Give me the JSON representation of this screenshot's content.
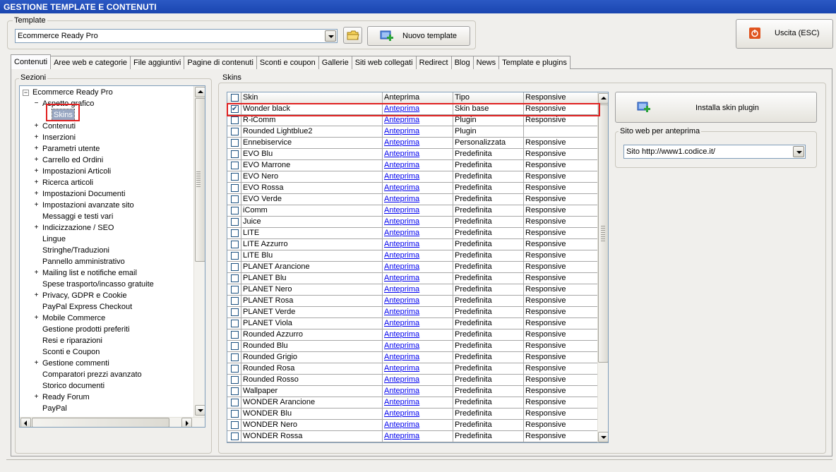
{
  "window": {
    "title": "GESTIONE TEMPLATE E CONTENUTI"
  },
  "template_group": {
    "label": "Template",
    "selected": "Ecommerce Ready Pro",
    "new_button": "Nuovo template"
  },
  "exit_button": "Uscita (ESC)",
  "tabs": [
    {
      "label": "Contenuti",
      "active": true
    },
    {
      "label": "Aree web e categorie"
    },
    {
      "label": "File aggiuntivi"
    },
    {
      "label": "Pagine di contenuti"
    },
    {
      "label": "Sconti e coupon"
    },
    {
      "label": "Gallerie"
    },
    {
      "label": "Siti web collegati"
    },
    {
      "label": "Redirect"
    },
    {
      "label": "Blog"
    },
    {
      "label": "News"
    },
    {
      "label": "Template e plugins"
    }
  ],
  "sections": {
    "label": "Sezioni",
    "root": "Ecommerce Ready Pro",
    "items": [
      {
        "label": "Aspetto grafico",
        "level": 1,
        "expander": "-"
      },
      {
        "label": "Skins",
        "level": 2,
        "expander": "",
        "selected": true
      },
      {
        "label": "Contenuti",
        "level": 1,
        "expander": "+"
      },
      {
        "label": "Inserzioni",
        "level": 1,
        "expander": "+"
      },
      {
        "label": "Parametri utente",
        "level": 1,
        "expander": "+"
      },
      {
        "label": "Carrello ed Ordini",
        "level": 1,
        "expander": "+"
      },
      {
        "label": "Impostazioni Articoli",
        "level": 1,
        "expander": "+"
      },
      {
        "label": "Ricerca articoli",
        "level": 1,
        "expander": "+"
      },
      {
        "label": "Impostazioni Documenti",
        "level": 1,
        "expander": "+"
      },
      {
        "label": "Impostazioni avanzate sito",
        "level": 1,
        "expander": "+"
      },
      {
        "label": "Messaggi e testi vari",
        "level": 1,
        "expander": ""
      },
      {
        "label": "Indicizzazione / SEO",
        "level": 1,
        "expander": "+"
      },
      {
        "label": "Lingue",
        "level": 1,
        "expander": ""
      },
      {
        "label": "Stringhe/Traduzioni",
        "level": 1,
        "expander": ""
      },
      {
        "label": "Pannello amministrativo",
        "level": 1,
        "expander": ""
      },
      {
        "label": "Mailing list e notifiche email",
        "level": 1,
        "expander": "+"
      },
      {
        "label": "Spese trasporto/incasso gratuite",
        "level": 1,
        "expander": ""
      },
      {
        "label": "Privacy, GDPR e Cookie",
        "level": 1,
        "expander": "+"
      },
      {
        "label": "PayPal Express Checkout",
        "level": 1,
        "expander": ""
      },
      {
        "label": "Mobile Commerce",
        "level": 1,
        "expander": "+"
      },
      {
        "label": "Gestione prodotti preferiti",
        "level": 1,
        "expander": ""
      },
      {
        "label": "Resi e riparazioni",
        "level": 1,
        "expander": ""
      },
      {
        "label": "Sconti e Coupon",
        "level": 1,
        "expander": ""
      },
      {
        "label": "Gestione commenti",
        "level": 1,
        "expander": "+"
      },
      {
        "label": "Comparatori prezzi avanzato",
        "level": 1,
        "expander": ""
      },
      {
        "label": "Storico documenti",
        "level": 1,
        "expander": ""
      },
      {
        "label": "Ready Forum",
        "level": 1,
        "expander": "+"
      },
      {
        "label": "PayPal",
        "level": 1,
        "expander": ""
      }
    ]
  },
  "skins": {
    "label": "Skins",
    "columns": [
      "Skin",
      "Anteprima",
      "Tipo",
      "Responsive"
    ],
    "rows": [
      {
        "checked": true,
        "skin": "Wonder black",
        "preview": "Anteprima",
        "type": "Skin base",
        "responsive": "Responsive"
      },
      {
        "checked": false,
        "skin": "R-iComm",
        "preview": "Anteprima",
        "type": "Plugin",
        "responsive": "Responsive"
      },
      {
        "checked": false,
        "skin": "Rounded Lightblue2",
        "preview": "Anteprima",
        "type": "Plugin",
        "responsive": ""
      },
      {
        "checked": false,
        "skin": "Ennebiservice",
        "preview": "Anteprima",
        "type": "Personalizzata",
        "responsive": "Responsive"
      },
      {
        "checked": false,
        "skin": "EVO Blu",
        "preview": "Anteprima",
        "type": "Predefinita",
        "responsive": "Responsive"
      },
      {
        "checked": false,
        "skin": "EVO Marrone",
        "preview": "Anteprima",
        "type": "Predefinita",
        "responsive": "Responsive"
      },
      {
        "checked": false,
        "skin": "EVO Nero",
        "preview": "Anteprima",
        "type": "Predefinita",
        "responsive": "Responsive"
      },
      {
        "checked": false,
        "skin": "EVO Rossa",
        "preview": "Anteprima",
        "type": "Predefinita",
        "responsive": "Responsive"
      },
      {
        "checked": false,
        "skin": "EVO Verde",
        "preview": "Anteprima",
        "type": "Predefinita",
        "responsive": "Responsive"
      },
      {
        "checked": false,
        "skin": "iComm",
        "preview": "Anteprima",
        "type": "Predefinita",
        "responsive": "Responsive"
      },
      {
        "checked": false,
        "skin": "Juice",
        "preview": "Anteprima",
        "type": "Predefinita",
        "responsive": "Responsive"
      },
      {
        "checked": false,
        "skin": "LITE",
        "preview": "Anteprima",
        "type": "Predefinita",
        "responsive": "Responsive"
      },
      {
        "checked": false,
        "skin": "LITE Azzurro",
        "preview": "Anteprima",
        "type": "Predefinita",
        "responsive": "Responsive"
      },
      {
        "checked": false,
        "skin": "LITE Blu",
        "preview": "Anteprima",
        "type": "Predefinita",
        "responsive": "Responsive"
      },
      {
        "checked": false,
        "skin": "PLANET Arancione",
        "preview": "Anteprima",
        "type": "Predefinita",
        "responsive": "Responsive"
      },
      {
        "checked": false,
        "skin": "PLANET Blu",
        "preview": "Anteprima",
        "type": "Predefinita",
        "responsive": "Responsive"
      },
      {
        "checked": false,
        "skin": "PLANET Nero",
        "preview": "Anteprima",
        "type": "Predefinita",
        "responsive": "Responsive"
      },
      {
        "checked": false,
        "skin": "PLANET Rosa",
        "preview": "Anteprima",
        "type": "Predefinita",
        "responsive": "Responsive"
      },
      {
        "checked": false,
        "skin": "PLANET Verde",
        "preview": "Anteprima",
        "type": "Predefinita",
        "responsive": "Responsive"
      },
      {
        "checked": false,
        "skin": "PLANET Viola",
        "preview": "Anteprima",
        "type": "Predefinita",
        "responsive": "Responsive"
      },
      {
        "checked": false,
        "skin": "Rounded Azzurro",
        "preview": "Anteprima",
        "type": "Predefinita",
        "responsive": "Responsive"
      },
      {
        "checked": false,
        "skin": "Rounded Blu",
        "preview": "Anteprima",
        "type": "Predefinita",
        "responsive": "Responsive"
      },
      {
        "checked": false,
        "skin": "Rounded Grigio",
        "preview": "Anteprima",
        "type": "Predefinita",
        "responsive": "Responsive"
      },
      {
        "checked": false,
        "skin": "Rounded Rosa",
        "preview": "Anteprima",
        "type": "Predefinita",
        "responsive": "Responsive"
      },
      {
        "checked": false,
        "skin": "Rounded Rosso",
        "preview": "Anteprima",
        "type": "Predefinita",
        "responsive": "Responsive"
      },
      {
        "checked": false,
        "skin": "Wallpaper",
        "preview": "Anteprima",
        "type": "Predefinita",
        "responsive": "Responsive"
      },
      {
        "checked": false,
        "skin": "WONDER Arancione",
        "preview": "Anteprima",
        "type": "Predefinita",
        "responsive": "Responsive"
      },
      {
        "checked": false,
        "skin": "WONDER Blu",
        "preview": "Anteprima",
        "type": "Predefinita",
        "responsive": "Responsive"
      },
      {
        "checked": false,
        "skin": "WONDER Nero",
        "preview": "Anteprima",
        "type": "Predefinita",
        "responsive": "Responsive"
      },
      {
        "checked": false,
        "skin": "WONDER Rossa",
        "preview": "Anteprima",
        "type": "Predefinita",
        "responsive": "Responsive"
      }
    ]
  },
  "install_button": "Installa skin plugin",
  "preview_site": {
    "label": "Sito web per anteprima",
    "selected": "Sito http://www1.codice.it/"
  },
  "colors": {
    "titlebar": "#2055c0",
    "highlight": "#e02020",
    "link": "#0000ee"
  }
}
